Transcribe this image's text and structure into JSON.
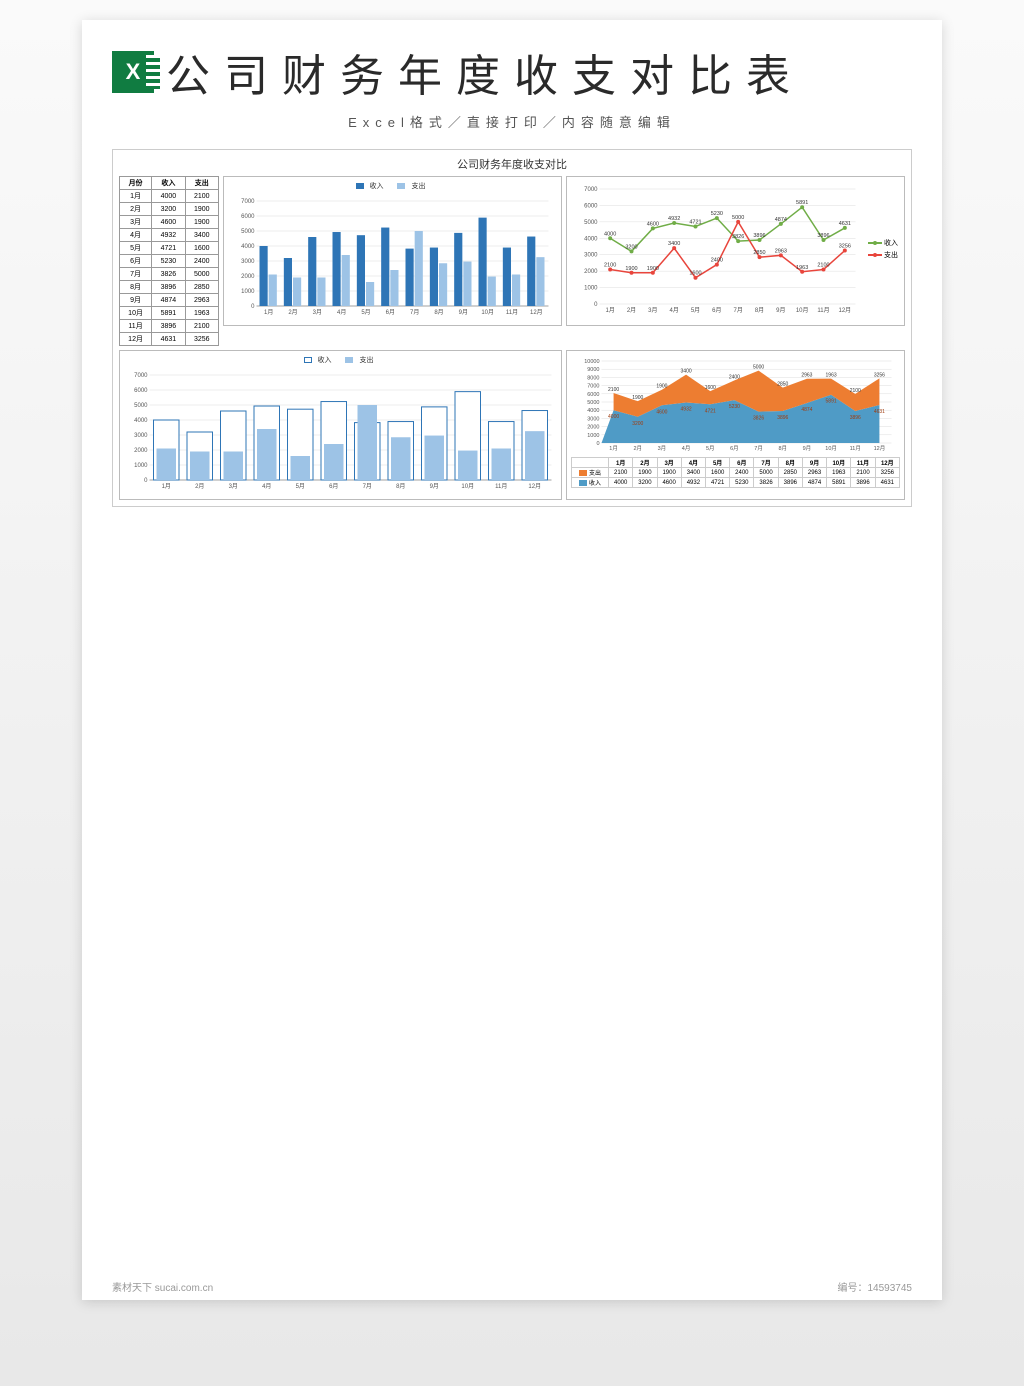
{
  "header": {
    "title": "公司财务年度收支对比表",
    "subtitle": "Excel格式／直接打印／内容随意编辑"
  },
  "doc_title": "公司财务年度收支对比",
  "table": {
    "headers": [
      "月份",
      "收入",
      "支出"
    ],
    "rows": [
      [
        "1月",
        4000,
        2100
      ],
      [
        "2月",
        3200,
        1900
      ],
      [
        "3月",
        4600,
        1900
      ],
      [
        "4月",
        4932,
        3400
      ],
      [
        "5月",
        4721,
        1600
      ],
      [
        "6月",
        5230,
        2400
      ],
      [
        "7月",
        3826,
        5000
      ],
      [
        "8月",
        3896,
        2850
      ],
      [
        "9月",
        4874,
        2963
      ],
      [
        "10月",
        5891,
        1963
      ],
      [
        "11月",
        3896,
        2100
      ],
      [
        "12月",
        4631,
        3256
      ]
    ]
  },
  "legend": {
    "income": "收入",
    "expense": "支出"
  },
  "footer": {
    "left": "素材天下 sucai.com.cn",
    "right": "编号：14593745"
  },
  "chart_data": [
    {
      "type": "bar",
      "title": "",
      "xlabel": "",
      "ylabel": "",
      "ylim": [
        0,
        7000
      ],
      "categories": [
        "1月",
        "2月",
        "3月",
        "4月",
        "5月",
        "6月",
        "7月",
        "8月",
        "9月",
        "10月",
        "11月",
        "12月"
      ],
      "series": [
        {
          "name": "收入",
          "color": "#2e75b6",
          "values": [
            4000,
            3200,
            4600,
            4932,
            4721,
            5230,
            3826,
            3896,
            4874,
            5891,
            3896,
            4631
          ]
        },
        {
          "name": "支出",
          "color": "#9dc3e6",
          "values": [
            2100,
            1900,
            1900,
            3400,
            1600,
            2400,
            5000,
            2850,
            2963,
            1963,
            2100,
            3256
          ]
        }
      ]
    },
    {
      "type": "line",
      "title": "",
      "xlabel": "",
      "ylabel": "",
      "ylim": [
        0,
        7000
      ],
      "categories": [
        "1月",
        "2月",
        "3月",
        "4月",
        "5月",
        "6月",
        "7月",
        "8月",
        "9月",
        "10月",
        "11月",
        "12月"
      ],
      "series": [
        {
          "name": "收入",
          "color": "#70ad47",
          "values": [
            4000,
            3200,
            4600,
            4932,
            4721,
            5230,
            3826,
            3896,
            4874,
            5891,
            3896,
            4631
          ]
        },
        {
          "name": "支出",
          "color": "#e8453c",
          "values": [
            2100,
            1900,
            1900,
            3400,
            1600,
            2400,
            5000,
            2850,
            2963,
            1963,
            2100,
            3256
          ]
        }
      ]
    },
    {
      "type": "bar",
      "variant": "overlay",
      "title": "",
      "xlabel": "",
      "ylabel": "",
      "ylim": [
        0,
        7000
      ],
      "categories": [
        "1月",
        "2月",
        "3月",
        "4月",
        "5月",
        "6月",
        "7月",
        "8月",
        "9月",
        "10月",
        "11月",
        "12月"
      ],
      "series": [
        {
          "name": "收入",
          "color": "#ffffff",
          "border": "#2e75b6",
          "values": [
            4000,
            3200,
            4600,
            4932,
            4721,
            5230,
            3826,
            3896,
            4874,
            5891,
            3896,
            4631
          ]
        },
        {
          "name": "支出",
          "color": "#9dc3e6",
          "values": [
            2100,
            1900,
            1900,
            3400,
            1600,
            2400,
            5000,
            2850,
            2963,
            1963,
            2100,
            3256
          ]
        }
      ]
    },
    {
      "type": "area",
      "title": "",
      "xlabel": "",
      "ylabel": "",
      "ylim": [
        0,
        10000
      ],
      "categories": [
        "1月",
        "2月",
        "3月",
        "4月",
        "5月",
        "6月",
        "7月",
        "8月",
        "9月",
        "10月",
        "11月",
        "12月"
      ],
      "series": [
        {
          "name": "支出",
          "color": "#ed7d31",
          "values": [
            2100,
            1900,
            1900,
            3400,
            1600,
            2400,
            5000,
            2850,
            2963,
            1963,
            2100,
            3256
          ]
        },
        {
          "name": "收入",
          "color": "#4f9bc6",
          "values": [
            4000,
            3200,
            4600,
            4932,
            4721,
            5230,
            3826,
            3896,
            4874,
            5891,
            3896,
            4631
          ]
        }
      ]
    }
  ]
}
